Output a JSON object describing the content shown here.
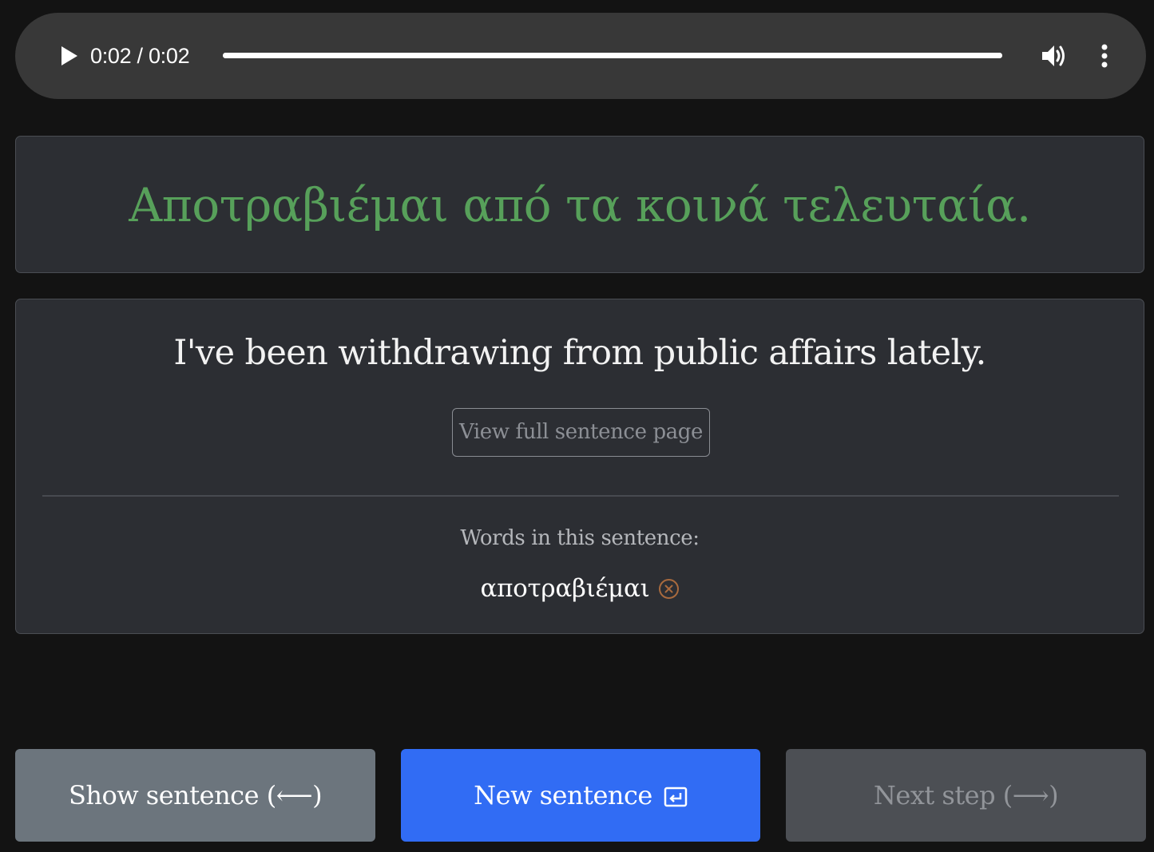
{
  "audio": {
    "time": "0:02 / 0:02",
    "progress": 1.0,
    "play_icon": "play-icon",
    "volume_icon": "volume-icon",
    "menu_icon": "more-vertical-icon"
  },
  "sentence": {
    "greek": "Αποτραβιέμαι από τα κοινά τελευταία.",
    "english": "I've been withdrawing from public affairs lately.",
    "view_full_label": "View full sentence page"
  },
  "words": {
    "heading": "Words in this sentence:",
    "items": [
      {
        "text": "αποτραβιέμαι",
        "remove_icon": "remove-circle-icon"
      }
    ]
  },
  "actions": {
    "show_sentence": "Show sentence (⟵)",
    "new_sentence": "New sentence",
    "new_sentence_icon": "enter-key-icon",
    "next_step": "Next step (⟶)"
  },
  "colors": {
    "background": "#131313",
    "panel": "#2c2e33",
    "greek_text": "#57a05a",
    "primary_button": "#316cf4",
    "secondary_button": "#6c757d",
    "disabled_button": "#4c4f54",
    "remove_icon": "#a86a3e"
  }
}
